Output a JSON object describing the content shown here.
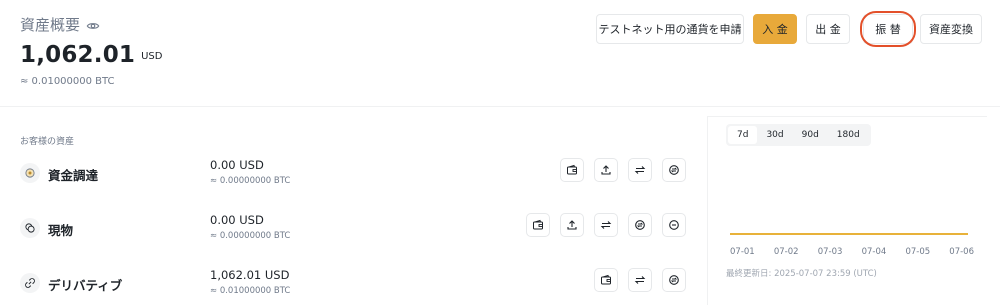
{
  "header": {
    "title": "資産概要",
    "balance": "1,062.01",
    "currency": "USD",
    "btc_equiv": "≈ 0.01000000 BTC"
  },
  "actions": {
    "testnet": "テストネット用の通貨を申請",
    "deposit": "入 金",
    "withdraw": "出 金",
    "transfer": "振 替",
    "convert": "資産変換"
  },
  "section_label": "お客様の資産",
  "accounts": [
    {
      "name": "資金調達",
      "amount": "0.00 USD",
      "btc": "≈ 0.00000000 BTC"
    },
    {
      "name": "現物",
      "amount": "0.00 USD",
      "btc": "≈ 0.00000000 BTC"
    },
    {
      "name": "デリバティブ",
      "amount": "1,062.01 USD",
      "btc": "≈ 0.01000000 BTC"
    }
  ],
  "chart": {
    "periods": [
      "7d",
      "30d",
      "90d",
      "180d"
    ],
    "selected_period": "7d",
    "x_labels": [
      "07-01",
      "07-02",
      "07-03",
      "07-04",
      "07-05",
      "07-06"
    ],
    "updated": "最終更新日: 2025-07-07 23:59 (UTC)",
    "line_color": "#e8b23a"
  },
  "colors": {
    "primary": "#e8a93a",
    "highlight_circle": "#e3502a"
  }
}
